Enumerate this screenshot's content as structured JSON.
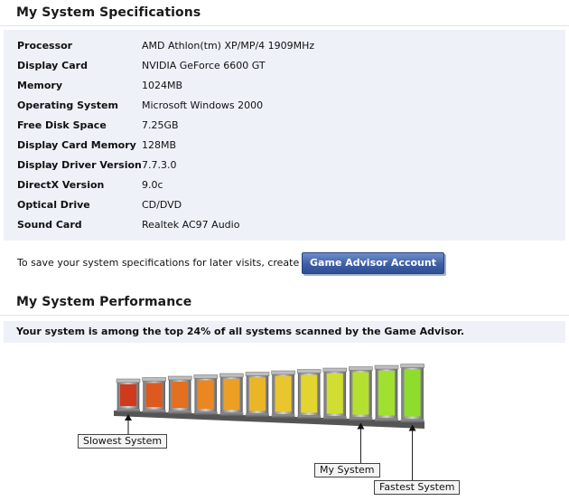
{
  "specs": {
    "title": "My System Specifications",
    "rows": [
      {
        "label": "Processor",
        "value": "AMD Athlon(tm) XP/MP/4 1909MHz"
      },
      {
        "label": "Display Card",
        "value": "NVIDIA GeForce 6600 GT"
      },
      {
        "label": "Memory",
        "value": "1024MB"
      },
      {
        "label": "Operating System",
        "value": "Microsoft Windows 2000"
      },
      {
        "label": "Free Disk Space",
        "value": "7.25GB"
      },
      {
        "label": "Display Card Memory",
        "value": "128MB"
      },
      {
        "label": "Display Driver Version",
        "value": "7.7.3.0"
      },
      {
        "label": "DirectX Version",
        "value": "9.0c"
      },
      {
        "label": "Optical Drive",
        "value": "CD/DVD"
      },
      {
        "label": "Sound Card",
        "value": "Realtek AC97 Audio"
      }
    ]
  },
  "save": {
    "text": "To save your system specifications for later visits, create a free",
    "button_label": "Game Advisor Account"
  },
  "performance": {
    "title": "My System Performance",
    "summary": "Your system is among the top 24% of all systems scanned by the Game Advisor.",
    "bar_count": 12,
    "system_bar_index": 9,
    "labels": {
      "slowest": "Slowest System",
      "mine": "My System",
      "fastest": "Fastest System"
    }
  }
}
